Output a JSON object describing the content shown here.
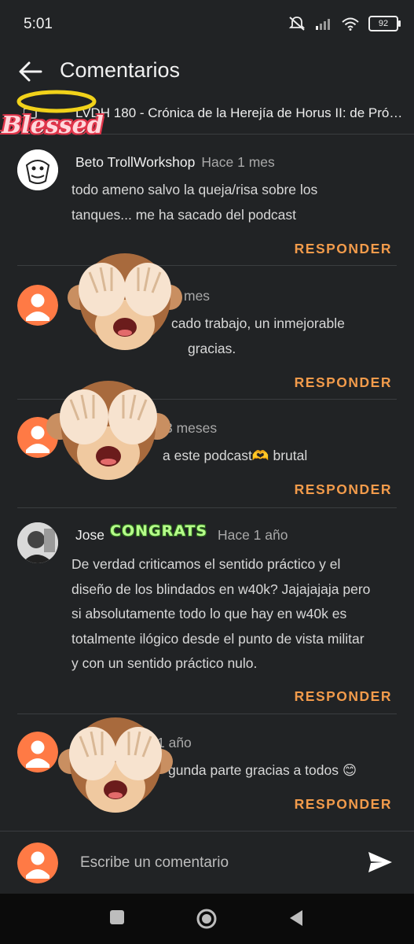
{
  "status_bar": {
    "time": "5:01",
    "battery": "92"
  },
  "header": {
    "title": "Comentarios"
  },
  "video": {
    "title": "LVDH 180 - Crónica de la Herejía de Horus II: de Pró…"
  },
  "comments": [
    {
      "author": "Beto TrollWorkshop",
      "time": "Hace 1 mes",
      "lines": [
        "todo ameno salvo la queja/risa sobre los",
        "tanques... me ha sacado del podcast"
      ],
      "reply": "RESPONDER"
    },
    {
      "author": "",
      "time": "mes",
      "lines": [
        "cado trabajo, un inmejorable",
        "gracias."
      ],
      "reply": "RESPONDER"
    },
    {
      "author": "",
      "time": "3 meses",
      "lines": [
        "a este podcast🫶 brutal"
      ],
      "reply": "RESPONDER"
    },
    {
      "author": "Jose",
      "time": "Hace 1 año",
      "lines": [
        "De verdad criticamos el sentido práctico y el",
        "diseño de los blindados en w40k? Jajajajaja pero",
        "si absolutamente todo lo que hay en w40k es",
        "totalmente ilógico desde el punto de vista militar",
        "y con un sentido práctico nulo."
      ],
      "reply": "RESPONDER"
    },
    {
      "author": "",
      "time": "1 año",
      "lines": [
        "gunda parte gracias a todos 😊"
      ],
      "reply": "RESPONDER"
    }
  ],
  "compose": {
    "placeholder": "Escribe un comentario"
  },
  "stickers": {
    "blessed": "Blessed",
    "congrats": "CONGRATS"
  },
  "colors": {
    "accent": "#f29b4b",
    "background": "#212325",
    "avatar": "#ff7a45"
  }
}
